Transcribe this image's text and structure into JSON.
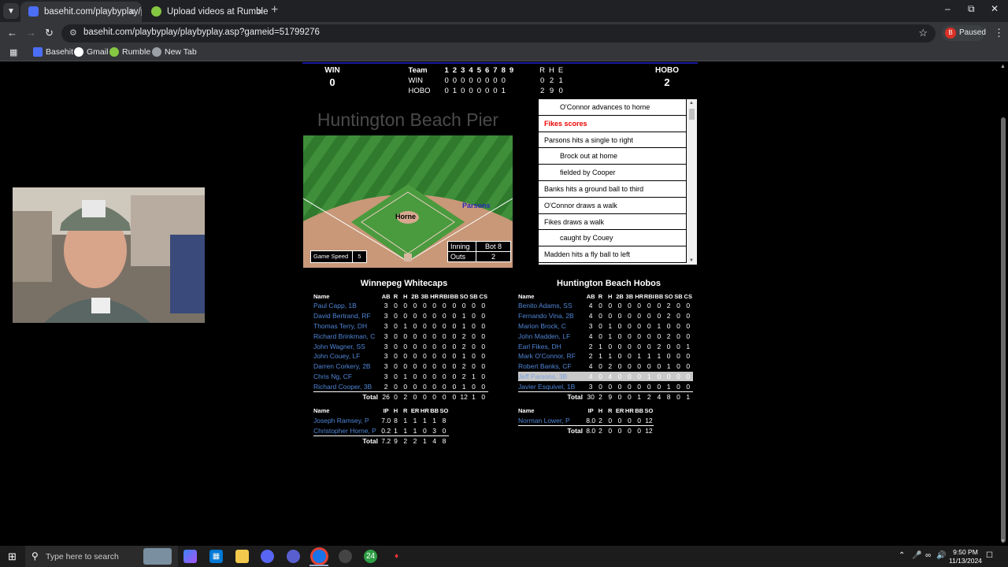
{
  "browser": {
    "tabs": [
      {
        "title": "basehit.com/playbyplay/playbyp",
        "active": true,
        "icon": "basehit-favicon"
      },
      {
        "title": "Upload videos at Rumble",
        "active": false,
        "icon": "rumble-favicon"
      }
    ],
    "new_tab_label": "+",
    "url": "basehit.com/playbyplay/playbyplay.asp?gameid=51799276",
    "profile_initial": "B",
    "profile_status": "Paused",
    "bookmarks": [
      {
        "label": "Basehit",
        "icon": "basehit-icon",
        "color": "#4c6ef5"
      },
      {
        "label": "Gmail",
        "icon": "google-icon",
        "color": "#ffffff"
      },
      {
        "label": "Rumble",
        "icon": "rumble-icon",
        "color": "#85c742"
      },
      {
        "label": "New Tab",
        "icon": "globe-icon",
        "color": "#9aa0a6"
      }
    ]
  },
  "scoreboard": {
    "away_abbr": "WIN",
    "away_runs": "0",
    "home_abbr": "HOBO",
    "home_runs": "2",
    "header": [
      "Team",
      "1",
      "2",
      "3",
      "4",
      "5",
      "6",
      "7",
      "8",
      "9",
      "R",
      "H",
      "E"
    ],
    "rows": [
      {
        "team": "WIN",
        "innings": [
          "0",
          "0",
          "0",
          "0",
          "0",
          "0",
          "0",
          "0",
          ""
        ],
        "r": "0",
        "h": "2",
        "e": "1"
      },
      {
        "team": "HOBO",
        "innings": [
          "0",
          "1",
          "0",
          "0",
          "0",
          "0",
          "0",
          "1",
          ""
        ],
        "r": "2",
        "h": "9",
        "e": "0"
      }
    ]
  },
  "ballpark": "Huntington Beach Pier",
  "field": {
    "pitcher": "Horne",
    "batter": "Parsons",
    "game_speed_label": "Game Speed",
    "game_speed": "5",
    "inning_label": "Inning",
    "inning": "Bot 8",
    "outs_label": "Outs",
    "outs": "2"
  },
  "play_by_play": [
    {
      "text": "O'Connor advances to home",
      "indent": true,
      "highlight": false
    },
    {
      "text": "Fikes scores",
      "indent": false,
      "highlight": true
    },
    {
      "text": "Parsons hits a single to right",
      "indent": false,
      "highlight": false
    },
    {
      "text": "Brock out at home",
      "indent": true,
      "highlight": false
    },
    {
      "text": "fielded by Cooper",
      "indent": true,
      "highlight": false
    },
    {
      "text": "Banks hits a ground ball to third",
      "indent": false,
      "highlight": false
    },
    {
      "text": "O'Connor draws a walk",
      "indent": false,
      "highlight": false
    },
    {
      "text": "Fikes draws a walk",
      "indent": false,
      "highlight": false
    },
    {
      "text": "caught by Couey",
      "indent": true,
      "highlight": false
    },
    {
      "text": "Madden hits a fly ball to left",
      "indent": false,
      "highlight": false
    }
  ],
  "away_box": {
    "team": "Winnepeg Whitecaps",
    "bat_cols": [
      "Name",
      "AB",
      "R",
      "H",
      "2B",
      "3B",
      "HR",
      "RBI",
      "BB",
      "SO",
      "SB",
      "CS"
    ],
    "batters": [
      [
        "Paul Capp, 1B",
        "3",
        "0",
        "0",
        "0",
        "0",
        "0",
        "0",
        "0",
        "0",
        "0",
        "0"
      ],
      [
        "David Bertrand, RF",
        "3",
        "0",
        "0",
        "0",
        "0",
        "0",
        "0",
        "0",
        "1",
        "0",
        "0"
      ],
      [
        "Thomas Terry, DH",
        "3",
        "0",
        "1",
        "0",
        "0",
        "0",
        "0",
        "0",
        "1",
        "0",
        "0"
      ],
      [
        "Richard Brinkman, C",
        "3",
        "0",
        "0",
        "0",
        "0",
        "0",
        "0",
        "0",
        "2",
        "0",
        "0"
      ],
      [
        "John Wagner, SS",
        "3",
        "0",
        "0",
        "0",
        "0",
        "0",
        "0",
        "0",
        "2",
        "0",
        "0"
      ],
      [
        "John Couey, LF",
        "3",
        "0",
        "0",
        "0",
        "0",
        "0",
        "0",
        "0",
        "1",
        "0",
        "0"
      ],
      [
        "Darren Corkery, 2B",
        "3",
        "0",
        "0",
        "0",
        "0",
        "0",
        "0",
        "0",
        "2",
        "0",
        "0"
      ],
      [
        "Chris Ng, CF",
        "3",
        "0",
        "1",
        "0",
        "0",
        "0",
        "0",
        "0",
        "2",
        "1",
        "0"
      ],
      [
        "Richard Cooper, 3B",
        "2",
        "0",
        "0",
        "0",
        "0",
        "0",
        "0",
        "0",
        "1",
        "0",
        "0"
      ]
    ],
    "bat_total": [
      "Total",
      "26",
      "0",
      "2",
      "0",
      "0",
      "0",
      "0",
      "0",
      "12",
      "1",
      "0"
    ],
    "pit_cols": [
      "Name",
      "IP",
      "H",
      "R",
      "ER",
      "HR",
      "BB",
      "SO"
    ],
    "pitchers": [
      [
        "Joseph Ramsey, P",
        "7.0",
        "8",
        "1",
        "1",
        "1",
        "1",
        "8"
      ],
      [
        "Christopher Horne, P",
        "0.2",
        "1",
        "1",
        "1",
        "0",
        "3",
        "0"
      ]
    ],
    "pit_total": [
      "Total",
      "7.2",
      "9",
      "2",
      "2",
      "1",
      "4",
      "8"
    ]
  },
  "home_box": {
    "team": "Huntington Beach Hobos",
    "bat_cols": [
      "Name",
      "AB",
      "R",
      "H",
      "2B",
      "3B",
      "HR",
      "RBI",
      "BB",
      "SO",
      "SB",
      "CS"
    ],
    "batters": [
      [
        "Benito Adams, SS",
        "4",
        "0",
        "0",
        "0",
        "0",
        "0",
        "0",
        "0",
        "2",
        "0",
        "0"
      ],
      [
        "Fernando Vina, 2B",
        "4",
        "0",
        "0",
        "0",
        "0",
        "0",
        "0",
        "0",
        "2",
        "0",
        "0"
      ],
      [
        "Marion Brock, C",
        "3",
        "0",
        "1",
        "0",
        "0",
        "0",
        "0",
        "1",
        "0",
        "0",
        "0"
      ],
      [
        "John Madden, LF",
        "4",
        "0",
        "1",
        "0",
        "0",
        "0",
        "0",
        "0",
        "2",
        "0",
        "0"
      ],
      [
        "Earl Fikes, DH",
        "2",
        "1",
        "0",
        "0",
        "0",
        "0",
        "0",
        "2",
        "0",
        "0",
        "1"
      ],
      [
        "Mark O'Connor, RF",
        "2",
        "1",
        "1",
        "0",
        "0",
        "1",
        "1",
        "1",
        "0",
        "0",
        "0"
      ],
      [
        "Robert Banks, CF",
        "4",
        "0",
        "2",
        "0",
        "0",
        "0",
        "0",
        "0",
        "1",
        "0",
        "0"
      ],
      [
        "Jeff Parsons, 3B",
        "4",
        "0",
        "4",
        "0",
        "0",
        "0",
        "1",
        "0",
        "0",
        "0",
        "0"
      ],
      [
        "Javier Esquivel, 1B",
        "3",
        "0",
        "0",
        "0",
        "0",
        "0",
        "0",
        "0",
        "1",
        "0",
        "0"
      ]
    ],
    "highlighted_batter_index": 7,
    "bat_total": [
      "Total",
      "30",
      "2",
      "9",
      "0",
      "0",
      "1",
      "2",
      "4",
      "8",
      "0",
      "1"
    ],
    "pit_cols": [
      "Name",
      "IP",
      "H",
      "R",
      "ER",
      "HR",
      "BB",
      "SO"
    ],
    "pitchers": [
      [
        "Norman Lower, P",
        "8.0",
        "2",
        "0",
        "0",
        "0",
        "0",
        "12"
      ]
    ],
    "pit_total": [
      "Total",
      "8.0",
      "2",
      "0",
      "0",
      "0",
      "0",
      "12"
    ]
  },
  "taskbar": {
    "search_placeholder": "Type here to search",
    "time": "9:50 PM",
    "date": "11/13/2024"
  }
}
